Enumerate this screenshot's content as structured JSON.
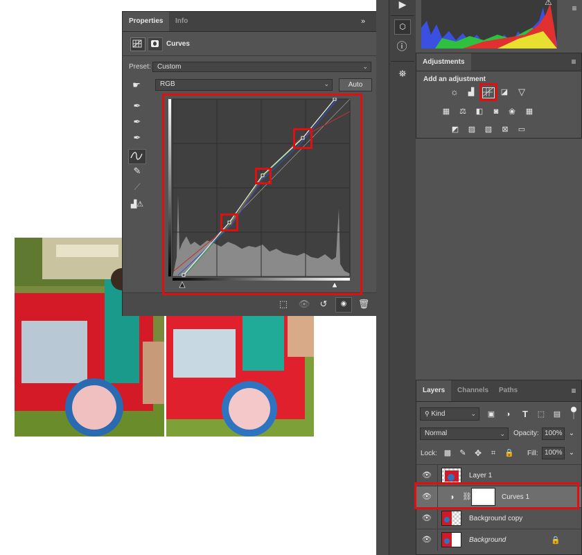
{
  "properties": {
    "tabs": [
      "Properties",
      "Info"
    ],
    "title": "Curves",
    "preset_label": "Preset:",
    "preset_value": "Custom",
    "channel_value": "RGB",
    "auto_label": "Auto"
  },
  "adjustments": {
    "tab": "Adjustments",
    "heading": "Add an adjustment"
  },
  "layers": {
    "tabs": [
      "Layers",
      "Channels",
      "Paths"
    ],
    "filter_kind": "Kind",
    "blend_mode": "Normal",
    "opacity_label": "Opacity:",
    "opacity_value": "100%",
    "lock_label": "Lock:",
    "fill_label": "Fill:",
    "fill_value": "100%",
    "items": [
      {
        "name": "Layer 1"
      },
      {
        "name": "Curves 1"
      },
      {
        "name": "Background copy"
      },
      {
        "name": "Background"
      }
    ]
  },
  "colors": {
    "panel_bg": "#535353",
    "highlight_red": "#e01010"
  }
}
